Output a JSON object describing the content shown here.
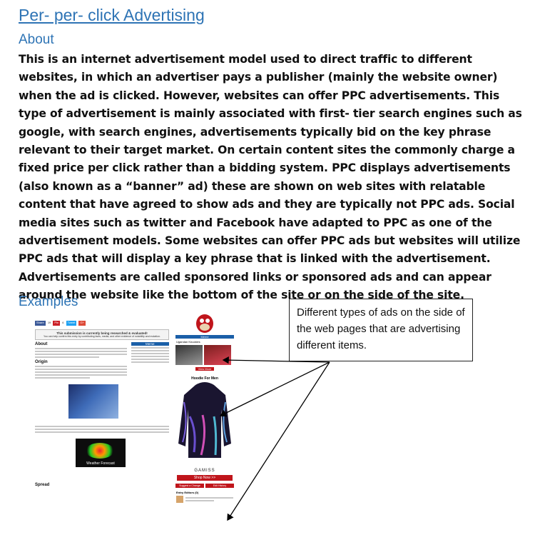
{
  "title": "Per- per- click Advertising",
  "about_heading": "About",
  "paragraph": "This is an internet advertisement model used to direct traffic to different websites, in which an advertiser pays a publisher (mainly the website owner) when the ad is clicked. However, websites can offer PPC advertisements. This type of advertisement is mainly associated with first- tier search engines such as google, with search engines, advertisements typically bid on the key phrase relevant to their target market. On certain content sites the commonly charge a fixed price per click rather than a bidding system. PPC displays advertisements (also known as a “banner” ad) these are shown on web sites with relatable content that have agreed to show ads and they are typically not PPC ads. Social media sites such as twitter and Facebook have adapted to PPC as one of the advertisement models. Some websites can offer PPC ads but websites will utilize PPC ads that will display a key phrase that is linked with the advertisement. Advertisements are called sponsored links or sponsored ads and can appear around the website like the bottom of the site or on the side of the site.",
  "examples_heading": "Examples",
  "callout_text": "Different types of ads on the side of the web pages that are advertising different items.",
  "screenshot": {
    "share": [
      "Share",
      "19",
      "Pin",
      "6",
      "Tweet",
      "G+"
    ],
    "notice_title": "This submission is currently being researched & evaluated!",
    "notice_sub": "You can help confirm this entry by contributing facts, media, and other evidence of notability and mutation.",
    "about": "About",
    "origin": "Origin",
    "meme": "Meme",
    "spread": "Spread",
    "weather_caption": "Weather Forecast"
  },
  "ads": {
    "hoodie_title": "Hoodie For Men",
    "brand": "GAMISS",
    "shop": "Shop Now >>",
    "suggest": "Suggest a Change",
    "edit": "Edit History",
    "entry_editors": "Entry Editors (0)",
    "meme_label": "Meme",
    "caption1": "Ugandan Knuckles",
    "view_more": "View More"
  },
  "colors": {
    "heading": "#2e74b5",
    "arrow": "#000000",
    "kym_blue": "#1a5fa8",
    "ad_red": "#c0151b"
  }
}
